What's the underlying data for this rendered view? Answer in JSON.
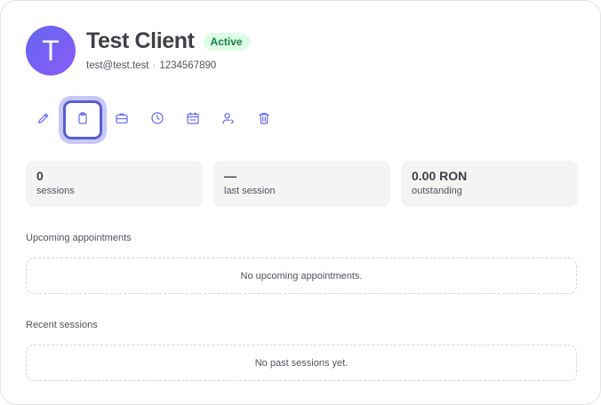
{
  "client": {
    "initial": "T",
    "name": "Test Client",
    "status": "Active",
    "email": "test@test.test",
    "separator": "·",
    "phone": "1234567890"
  },
  "toolbar": {
    "tools": [
      {
        "name": "edit",
        "icon": "pencil-icon"
      },
      {
        "name": "notes",
        "icon": "clipboard-icon",
        "active": true
      },
      {
        "name": "briefcase",
        "icon": "briefcase-icon"
      },
      {
        "name": "history",
        "icon": "clock-icon"
      },
      {
        "name": "schedule",
        "icon": "calendar-icon"
      },
      {
        "name": "assign",
        "icon": "user-arrow-icon"
      },
      {
        "name": "delete",
        "icon": "trash-icon"
      }
    ]
  },
  "stats": [
    {
      "value": "0",
      "label": "sessions"
    },
    {
      "value": "—",
      "label": "last session"
    },
    {
      "value": "0.00 RON",
      "label": "outstanding"
    }
  ],
  "upcoming": {
    "title": "Upcoming appointments",
    "empty": "No upcoming appointments."
  },
  "recent": {
    "title": "Recent sessions",
    "empty": "No past sessions yet."
  },
  "colors": {
    "accent": "#6366f1",
    "active_badge_bg": "#dcfce7",
    "active_badge_text": "#15803d"
  }
}
